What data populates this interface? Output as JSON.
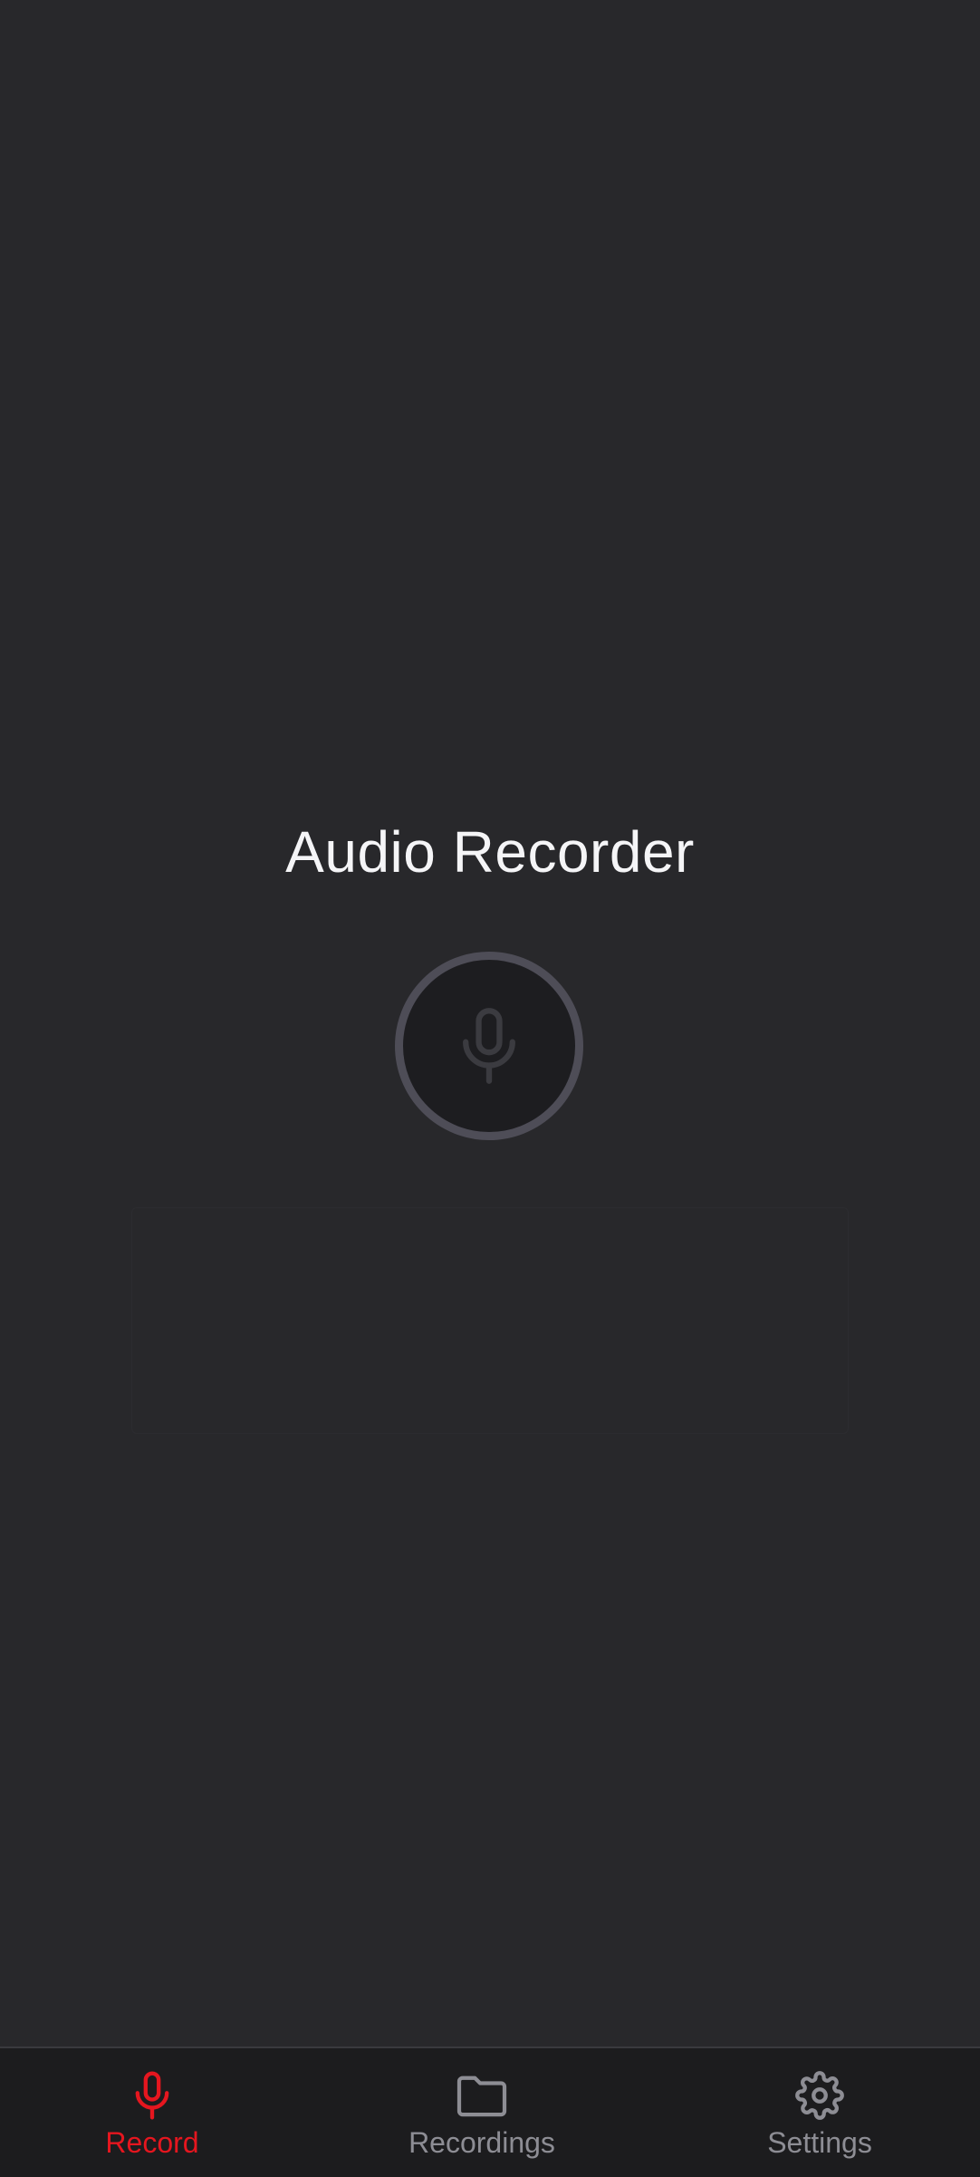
{
  "app": {
    "title": "Audio Recorder"
  },
  "record_button": {
    "icon": "microphone-icon",
    "state": "disabled"
  },
  "bottom_nav": {
    "active_color": "#e5161f",
    "inactive_color": "#8d8d94",
    "items": [
      {
        "label": "Record",
        "icon": "microphone-icon",
        "active": true
      },
      {
        "label": "Recordings",
        "icon": "folder-icon",
        "active": false
      },
      {
        "label": "Settings",
        "icon": "gear-icon",
        "active": false
      }
    ]
  }
}
